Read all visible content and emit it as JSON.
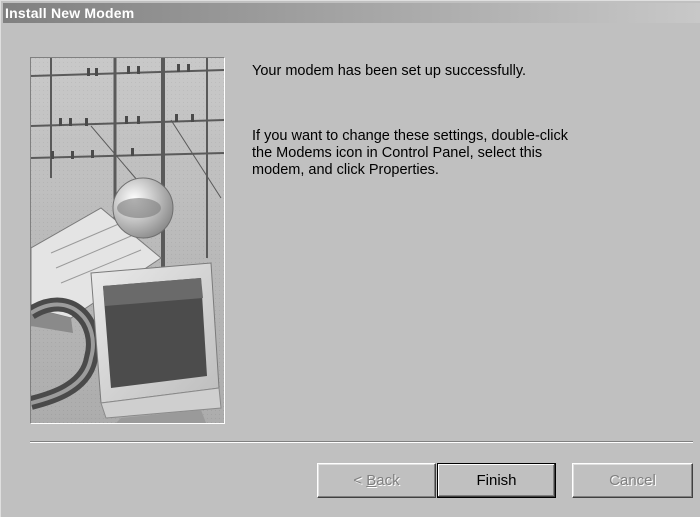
{
  "window": {
    "title": "Install New Modem"
  },
  "content": {
    "message_primary": "Your modem has been set up successfully.",
    "message_secondary": "If you want to change these settings, double-click\nthe Modems icon in Control Panel, select this\nmodem, and click Properties."
  },
  "buttons": {
    "back": {
      "prefix": "< ",
      "mnemonic": "B",
      "rest": "ack"
    },
    "finish": "Finish",
    "cancel": "Cancel"
  },
  "colors": {
    "dialog_face": "#c0c0c0",
    "titlebar_inactive": "#808080",
    "disabled_text": "#808080"
  }
}
